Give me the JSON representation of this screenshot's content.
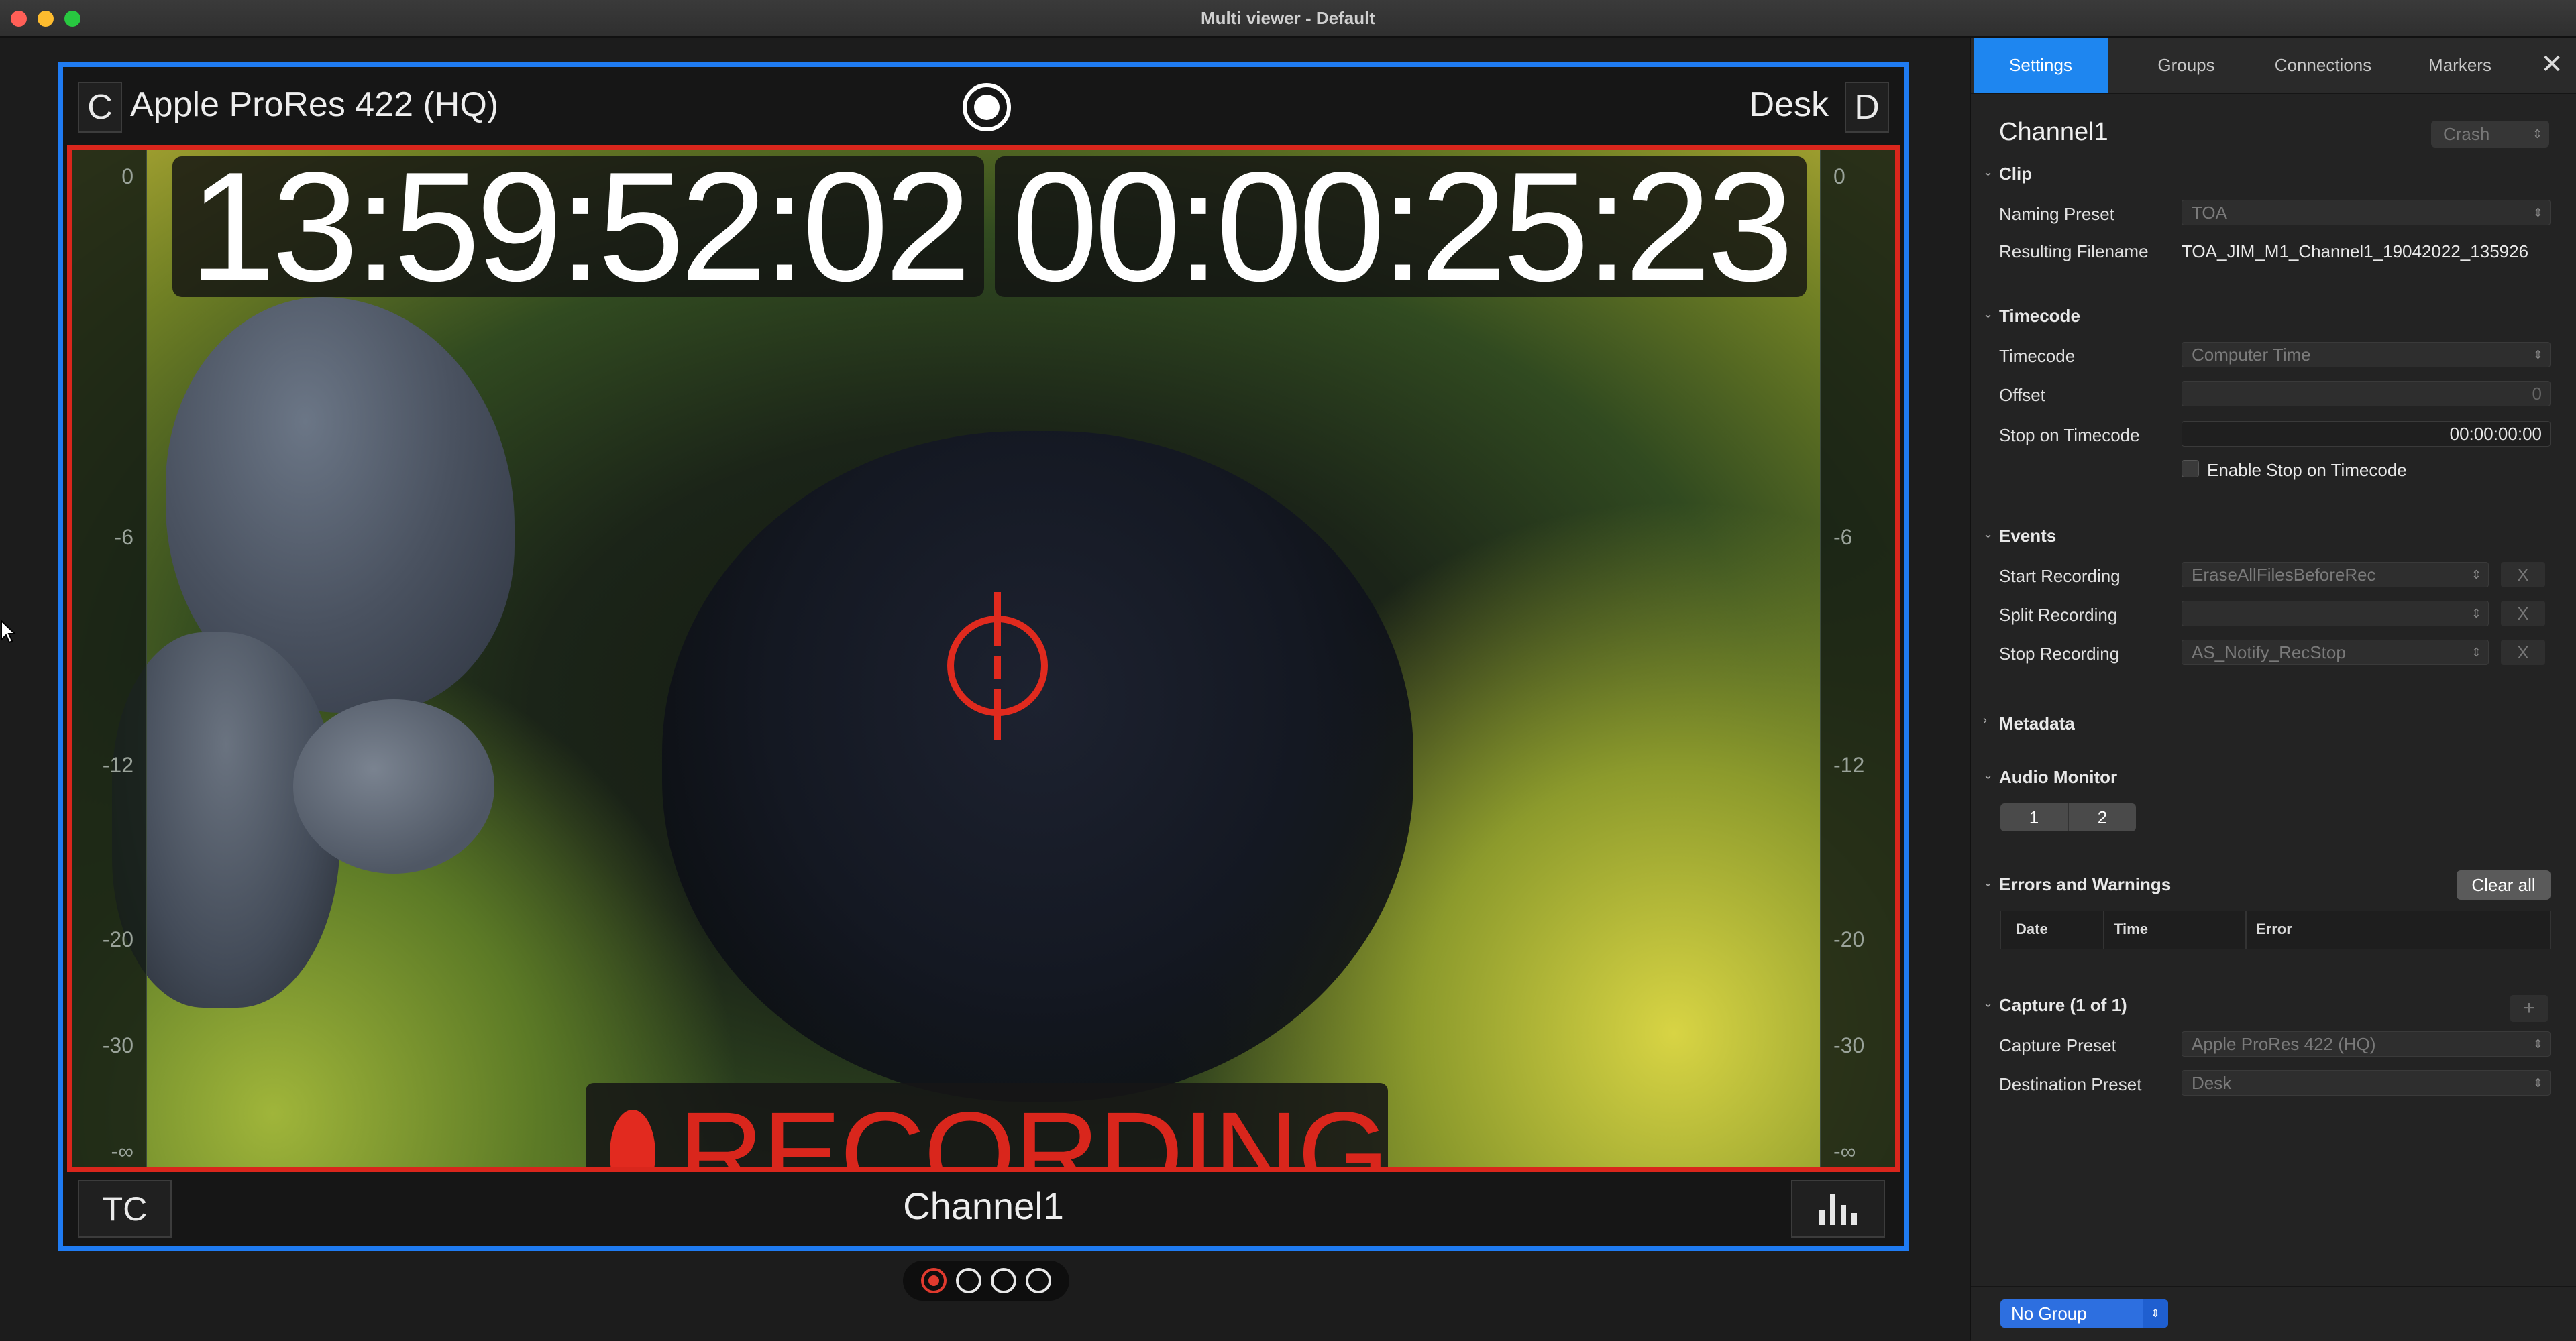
{
  "window": {
    "title": "Multi viewer - Default"
  },
  "viewer": {
    "top_left_letter": "C",
    "codec": "Apple ProRes 422 (HQ)",
    "destination": "Desk",
    "top_right_letter": "D",
    "timecode_1": "13:59:52:02",
    "timecode_2": "00:00:25:23",
    "meter_ticks": [
      "0",
      "-6",
      "-12",
      "-20",
      "-30",
      "-∞"
    ],
    "recording_label": "RECORDING",
    "tc_button": "TC",
    "channel_name": "Channel1"
  },
  "pager": {
    "page_count": 4,
    "active_page": 1
  },
  "panel": {
    "tabs": [
      "Settings",
      "Groups",
      "Connections",
      "Markers"
    ],
    "active_tab": "Settings",
    "channel_title": "Channel1",
    "crash_select": "Crash",
    "clip": {
      "heading": "Clip",
      "naming_preset_label": "Naming Preset",
      "naming_preset_value": "TOA",
      "resulting_filename_label": "Resulting Filename",
      "resulting_filename_value": "TOA_JIM_M1_Channel1_19042022_135926"
    },
    "timecode": {
      "heading": "Timecode",
      "timecode_label": "Timecode",
      "timecode_value": "Computer Time",
      "offset_label": "Offset",
      "offset_value": "0",
      "stop_label": "Stop on Timecode",
      "stop_value": "00:00:00:00",
      "enable_stop_label": "Enable Stop on Timecode"
    },
    "events": {
      "heading": "Events",
      "start_label": "Start Recording",
      "start_value": "EraseAllFilesBeforeRec",
      "split_label": "Split Recording",
      "split_value": "",
      "stop_label": "Stop Recording",
      "stop_value": "AS_Notify_RecStop",
      "clear_symbol": "X"
    },
    "metadata": {
      "heading": "Metadata"
    },
    "audio_monitor": {
      "heading": "Audio Monitor",
      "buttons": [
        "1",
        "2"
      ]
    },
    "errors": {
      "heading": "Errors and Warnings",
      "clear_all": "Clear all",
      "columns": [
        "Date",
        "Time",
        "Error"
      ]
    },
    "capture": {
      "heading": "Capture (1 of 1)",
      "add_symbol": "+",
      "capture_preset_label": "Capture Preset",
      "capture_preset_value": "Apple ProRes 422 (HQ)",
      "destination_preset_label": "Destination Preset",
      "destination_preset_value": "Desk"
    },
    "footer": {
      "group_select": "No Group"
    }
  },
  "colors": {
    "selection_border": "#1f7bf2",
    "recording_red": "#d9261c",
    "active_tab": "#1e86f0"
  }
}
